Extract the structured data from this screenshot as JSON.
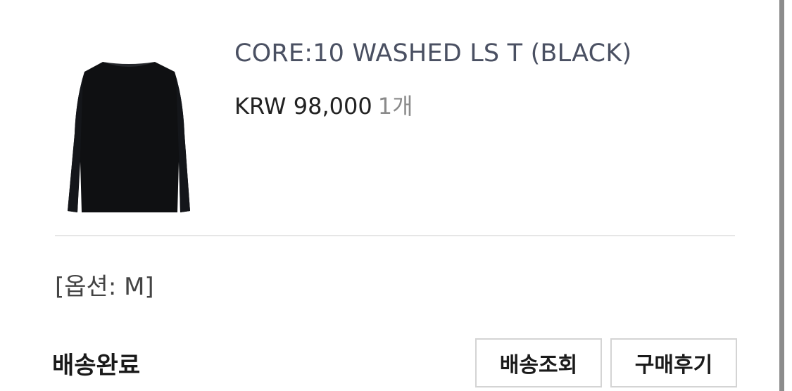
{
  "product": {
    "name": "CORE:10 WASHED LS T (BLACK)",
    "price": "KRW 98,000",
    "quantity": "1개",
    "image_icon": "black-long-sleeve-tshirt"
  },
  "option": {
    "label": "[옵션: M]"
  },
  "order": {
    "status": "배송완료"
  },
  "actions": {
    "track_label": "배송조회",
    "review_label": "구매후기"
  }
}
